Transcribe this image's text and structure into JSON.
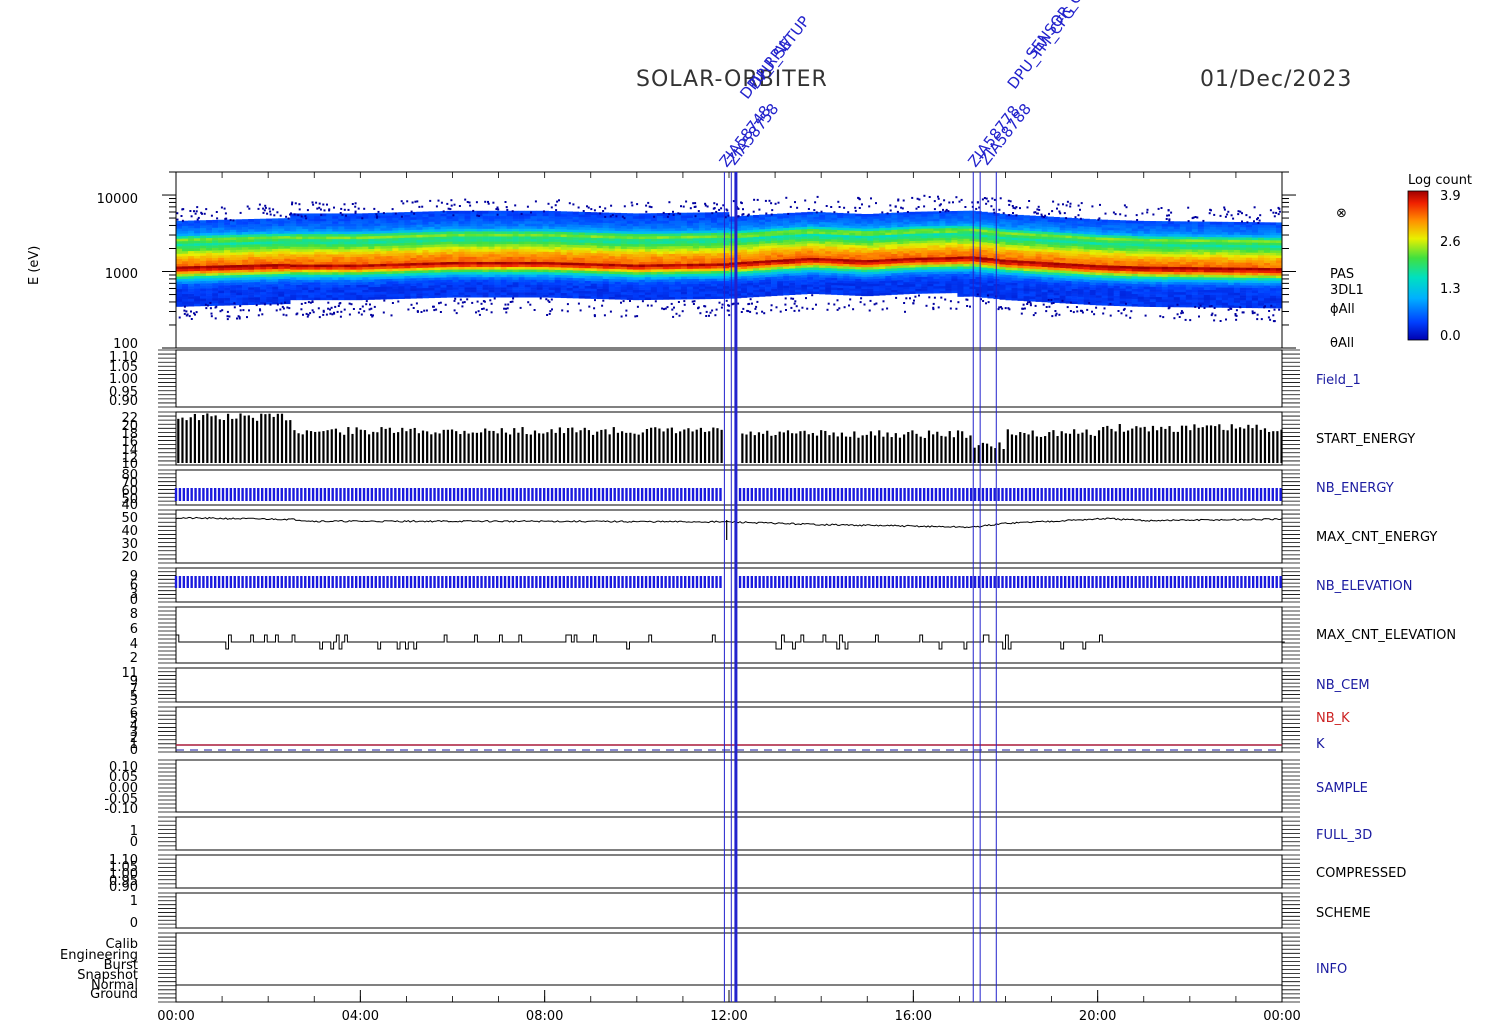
{
  "header": {
    "mission": "SOLAR-ORBITER",
    "date": "01/Dec/2023"
  },
  "colorbar": {
    "title": "Log count",
    "ticks": [
      "3.9",
      "2.6",
      "1.3",
      "0.0"
    ]
  },
  "spectrogram": {
    "ylabel": "E (eV)",
    "yticks": [
      "10000",
      "1000",
      "100"
    ],
    "labels": [
      "PAS",
      "3DL1",
      "ϕAll",
      "θAll"
    ],
    "symbol": "⊗"
  },
  "markers": {
    "labels": [
      "ZIA58748",
      "ZIA58758",
      "ZIA58778",
      "ZIA58788",
      "DPU_RPW",
      "DPU_SETUP",
      "DPU_TM_CFG",
      "SENSOR_ON"
    ],
    "color": "#2222cc"
  },
  "panels": [
    {
      "label": "Field_1",
      "color": "#1a1aa0",
      "ticks": [
        "1.10",
        "1.05",
        "1.00",
        "0.95",
        "0.90"
      ]
    },
    {
      "label": "START_ENERGY",
      "color": "#000000",
      "ticks": [
        "22",
        "20",
        "18",
        "16",
        "14",
        "12",
        "10"
      ]
    },
    {
      "label": "NB_ENERGY",
      "color": "#1a1aa0",
      "ticks": [
        "80",
        "70",
        "60",
        "50",
        "40"
      ]
    },
    {
      "label": "MAX_CNT_ENERGY",
      "color": "#000000",
      "ticks": [
        "50",
        "40",
        "30",
        "20"
      ]
    },
    {
      "label": "NB_ELEVATION",
      "color": "#1a1aa0",
      "ticks": [
        "9",
        "6",
        "3",
        "0"
      ]
    },
    {
      "label": "MAX_CNT_ELEVATION",
      "color": "#000000",
      "ticks": [
        "8",
        "6",
        "4",
        "2"
      ]
    },
    {
      "label": "NB_CEM",
      "color": "#1a1aa0",
      "ticks": [
        "11",
        "9",
        "7",
        "5",
        "3"
      ]
    },
    {
      "label": "NB_K",
      "label2": "K",
      "color": "#cc2222",
      "color2": "#1a1aa0",
      "ticks": [
        "6",
        "5",
        "4",
        "3",
        "2",
        "1",
        "0"
      ]
    },
    {
      "label": "SAMPLE",
      "color": "#1a1aa0",
      "ticks": [
        "0.10",
        "0.05",
        "0.00",
        "-0.05",
        "-0.10"
      ]
    },
    {
      "label": "FULL_3D",
      "color": "#1a1aa0",
      "ticks": [
        "1",
        "0"
      ]
    },
    {
      "label": "COMPRESSED",
      "color": "#000000",
      "ticks": [
        "1.10",
        "1.05",
        "1.00",
        "0.95",
        "0.90"
      ]
    },
    {
      "label": "SCHEME",
      "color": "#000000",
      "ticks": [
        "1",
        "0"
      ]
    },
    {
      "label": "INFO",
      "color": "#1a1aa0",
      "ticks": [
        "Calib",
        "Engineering",
        "Burst",
        "Snapshot",
        "Normal",
        "Ground"
      ]
    }
  ],
  "chart_data": {
    "type": "multi-panel time series with spectrogram",
    "x_axis": {
      "ticks": [
        "00:00",
        "04:00",
        "08:00",
        "12:00",
        "16:00",
        "20:00",
        "00:00"
      ],
      "range_hours": [
        0,
        24
      ]
    },
    "spectrogram": {
      "y_range_eV": [
        100,
        20000
      ],
      "log_scale": true,
      "peak_energy_eV": [
        [
          0,
          1100
        ],
        [
          2.5,
          1200
        ],
        [
          4,
          1200
        ],
        [
          6,
          1300
        ],
        [
          8,
          1300
        ],
        [
          10,
          1200
        ],
        [
          12,
          1250
        ],
        [
          13.8,
          1450
        ],
        [
          15,
          1350
        ],
        [
          16,
          1450
        ],
        [
          17.3,
          1500
        ],
        [
          18,
          1350
        ],
        [
          19,
          1250
        ],
        [
          20,
          1150
        ],
        [
          21,
          1100
        ],
        [
          24,
          1050
        ]
      ],
      "min_count_log": 0.0,
      "max_count_log": 3.9
    },
    "max_cnt_energy": [
      [
        0,
        49
      ],
      [
        2.5,
        48
      ],
      [
        3,
        46.5
      ],
      [
        8,
        46.5
      ],
      [
        12,
        46
      ],
      [
        14,
        44
      ],
      [
        17.3,
        42
      ],
      [
        18,
        45
      ],
      [
        20.2,
        48.5
      ],
      [
        21,
        47
      ],
      [
        24,
        48
      ]
    ],
    "max_cnt_elevation_baseline": 4,
    "marker_times_hours": [
      11.9,
      12.05,
      12.15,
      17.3,
      17.45,
      17.8
    ]
  }
}
